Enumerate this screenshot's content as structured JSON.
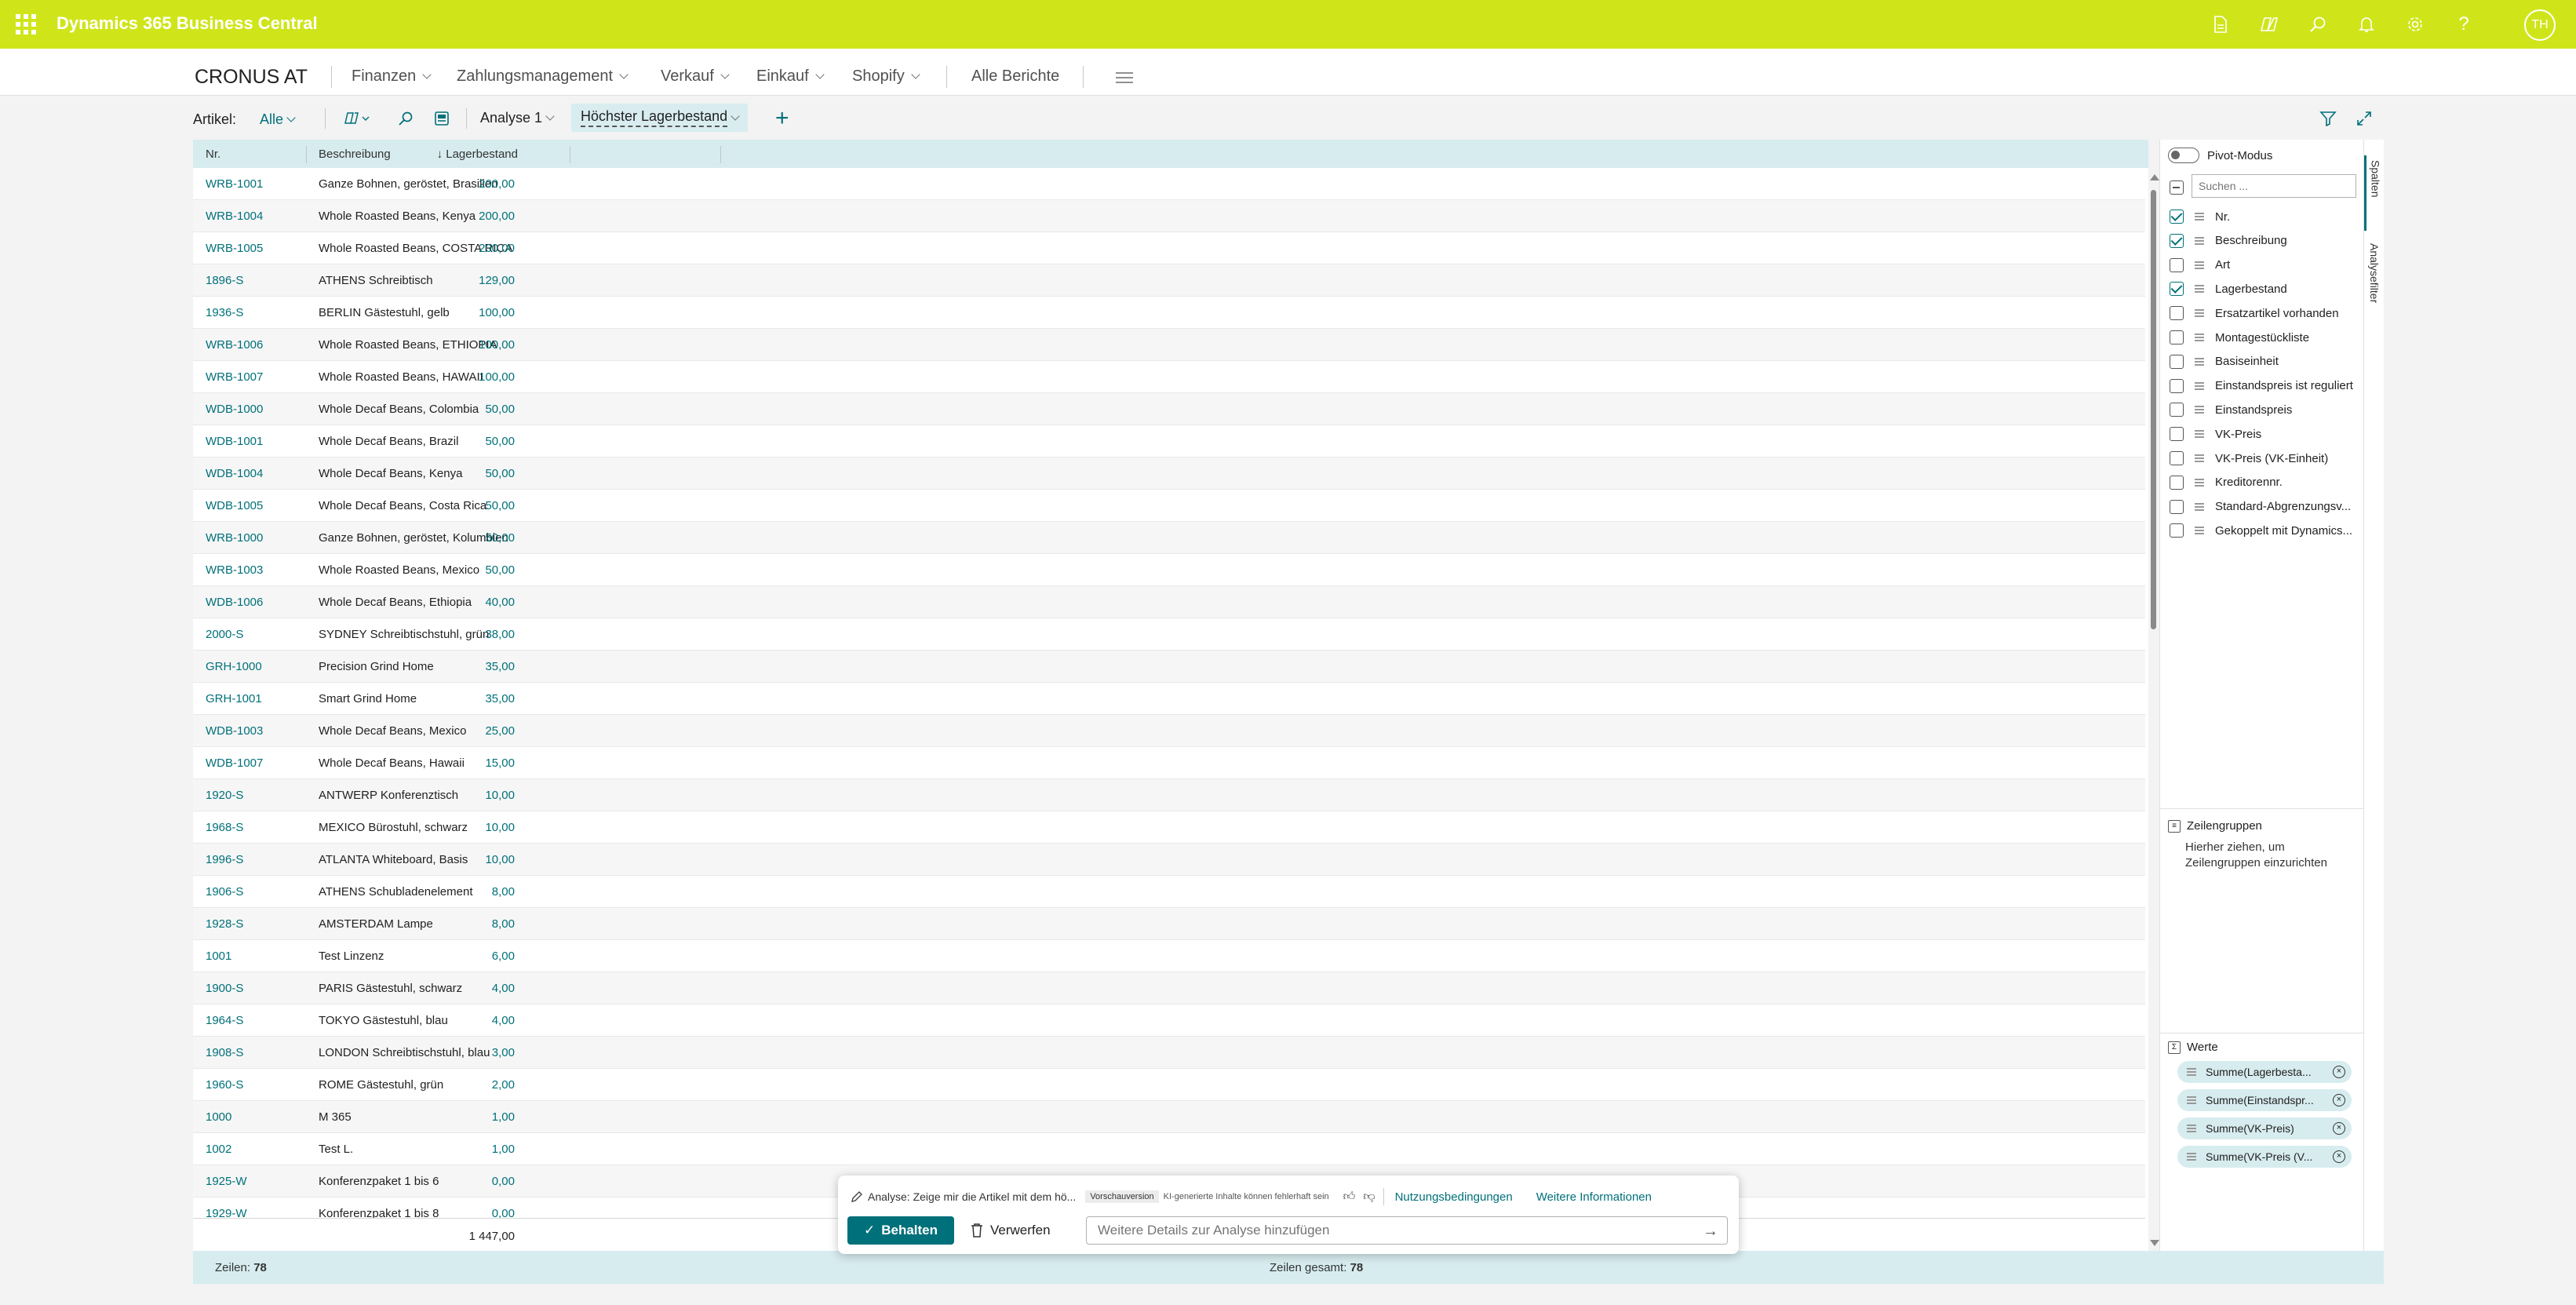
{
  "app": {
    "title": "Dynamics 365 Business Central",
    "user_initials": "TH"
  },
  "topbar_icons": [
    "document-icon",
    "copilot-icon",
    "search-icon",
    "bell-icon",
    "gear-icon",
    "help-icon"
  ],
  "nav": {
    "company": "CRONUS AT",
    "items": [
      "Finanzen",
      "Zahlungsmanagement",
      "Verkauf",
      "Einkauf",
      "Shopify"
    ],
    "all_reports": "Alle Berichte"
  },
  "toolbar": {
    "label": "Artikel:",
    "filter": "Alle",
    "tab1": "Analyse 1",
    "tab2": "Höchster Lagerbestand"
  },
  "grid": {
    "headers": {
      "no": "Nr.",
      "desc": "Beschreibung",
      "qty": "↓ Lagerbestand"
    },
    "rows": [
      [
        "WRB-1001",
        "Ganze Bohnen, geröstet, Brasilien",
        "200,00"
      ],
      [
        "WRB-1004",
        "Whole Roasted Beans, Kenya",
        "200,00"
      ],
      [
        "WRB-1005",
        "Whole Roasted Beans, COSTA RICA",
        "200,00"
      ],
      [
        "1896-S",
        "ATHENS Schreibtisch",
        "129,00"
      ],
      [
        "1936-S",
        "BERLIN Gästestuhl, gelb",
        "100,00"
      ],
      [
        "WRB-1006",
        "Whole Roasted Beans, ETHIOPIA",
        "100,00"
      ],
      [
        "WRB-1007",
        "Whole Roasted Beans, HAWAII",
        "100,00"
      ],
      [
        "WDB-1000",
        "Whole Decaf Beans, Colombia",
        "50,00"
      ],
      [
        "WDB-1001",
        "Whole Decaf Beans, Brazil",
        "50,00"
      ],
      [
        "WDB-1004",
        "Whole Decaf Beans, Kenya",
        "50,00"
      ],
      [
        "WDB-1005",
        "Whole Decaf Beans, Costa Rica",
        "50,00"
      ],
      [
        "WRB-1000",
        "Ganze Bohnen, geröstet, Kolumbien",
        "50,00"
      ],
      [
        "WRB-1003",
        "Whole Roasted Beans, Mexico",
        "50,00"
      ],
      [
        "WDB-1006",
        "Whole Decaf Beans, Ethiopia",
        "40,00"
      ],
      [
        "2000-S",
        "SYDNEY Schreibtischstuhl, grün",
        "38,00"
      ],
      [
        "GRH-1000",
        "Precision Grind Home",
        "35,00"
      ],
      [
        "GRH-1001",
        "Smart Grind Home",
        "35,00"
      ],
      [
        "WDB-1003",
        "Whole Decaf Beans, Mexico",
        "25,00"
      ],
      [
        "WDB-1007",
        "Whole Decaf Beans, Hawaii",
        "15,00"
      ],
      [
        "1920-S",
        "ANTWERP Konferenztisch",
        "10,00"
      ],
      [
        "1968-S",
        "MEXICO Bürostuhl, schwarz",
        "10,00"
      ],
      [
        "1996-S",
        "ATLANTA Whiteboard, Basis",
        "10,00"
      ],
      [
        "1906-S",
        "ATHENS Schubladenelement",
        "8,00"
      ],
      [
        "1928-S",
        "AMSTERDAM Lampe",
        "8,00"
      ],
      [
        "1001",
        "Test Linzenz",
        "6,00"
      ],
      [
        "1900-S",
        "PARIS Gästestuhl, schwarz",
        "4,00"
      ],
      [
        "1964-S",
        "TOKYO Gästestuhl, blau",
        "4,00"
      ],
      [
        "1908-S",
        "LONDON Schreibtischstuhl, blau",
        "3,00"
      ],
      [
        "1960-S",
        "ROME Gästestuhl, grün",
        "2,00"
      ],
      [
        "1000",
        "M 365",
        "1,00"
      ],
      [
        "1002",
        "Test L.",
        "1,00"
      ],
      [
        "1925-W",
        "Konferenzpaket 1 bis 6",
        "0,00"
      ],
      [
        "1929-W",
        "Konferenzpaket 1 bis 8",
        "0,00"
      ]
    ],
    "total": "1 447,00"
  },
  "footer": {
    "rows_label": "Zeilen:",
    "rows_count": "78",
    "total_label": "Zeilen gesamt:",
    "total_count": "78"
  },
  "side": {
    "pivot": "Pivot-Modus",
    "search_placeholder": "Suchen ...",
    "columns": [
      {
        "label": "Nr.",
        "checked": true
      },
      {
        "label": "Beschreibung",
        "checked": true
      },
      {
        "label": "Art",
        "checked": false
      },
      {
        "label": "Lagerbestand",
        "checked": true
      },
      {
        "label": "Ersatzartikel vorhanden",
        "checked": false
      },
      {
        "label": "Montagestückliste",
        "checked": false
      },
      {
        "label": "Basiseinheit",
        "checked": false
      },
      {
        "label": "Einstandspreis ist reguliert",
        "checked": false
      },
      {
        "label": "Einstandspreis",
        "checked": false
      },
      {
        "label": "VK-Preis",
        "checked": false
      },
      {
        "label": "VK-Preis (VK-Einheit)",
        "checked": false
      },
      {
        "label": "Kreditorennr.",
        "checked": false
      },
      {
        "label": "Standard-Abgrenzungsv...",
        "checked": false
      },
      {
        "label": "Gekoppelt mit Dynamics...",
        "checked": false
      }
    ],
    "row_groups_title": "Zeilengruppen",
    "row_groups_hint": "Hierher ziehen, um Zeilengruppen einzurichten",
    "values_title": "Werte",
    "values": [
      "Summe(Lagerbesta...",
      "Summe(Einstandspr...",
      "Summe(VK-Preis)",
      "Summe(VK-Preis (V..."
    ]
  },
  "vtabs": {
    "columns": "Spalten",
    "filters": "Analysefilter"
  },
  "ai": {
    "prompt": "Analyse: Zeige mir die Artikel mit dem hö...",
    "badge": "Vorschauversion",
    "note": "KI-generierte Inhalte können fehlerhaft sein",
    "terms": "Nutzungsbedingungen",
    "more": "Weitere Informationen",
    "keep": "Behalten",
    "discard": "Verwerfen",
    "input_placeholder": "Weitere Details zur Analyse hinzufügen"
  }
}
